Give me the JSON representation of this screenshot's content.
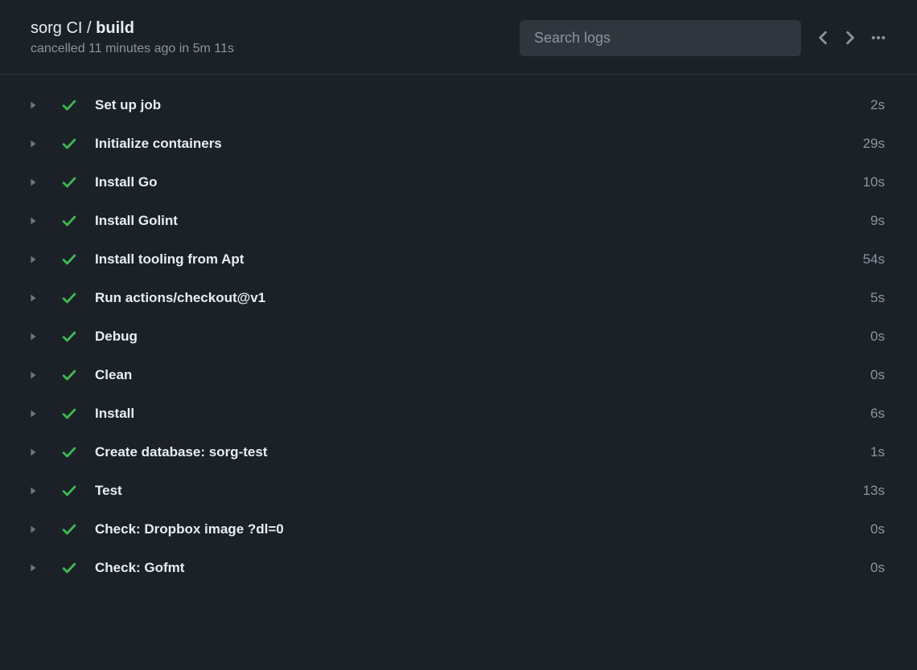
{
  "header": {
    "workflow_name": "sorg CI",
    "separator": " / ",
    "job_name": "build",
    "status_text": "cancelled 11 minutes ago in 5m 11s",
    "search_placeholder": "Search logs"
  },
  "steps": [
    {
      "name": "Set up job",
      "duration": "2s",
      "status": "success"
    },
    {
      "name": "Initialize containers",
      "duration": "29s",
      "status": "success"
    },
    {
      "name": "Install Go",
      "duration": "10s",
      "status": "success"
    },
    {
      "name": "Install Golint",
      "duration": "9s",
      "status": "success"
    },
    {
      "name": "Install tooling from Apt",
      "duration": "54s",
      "status": "success"
    },
    {
      "name": "Run actions/checkout@v1",
      "duration": "5s",
      "status": "success"
    },
    {
      "name": "Debug",
      "duration": "0s",
      "status": "success"
    },
    {
      "name": "Clean",
      "duration": "0s",
      "status": "success"
    },
    {
      "name": "Install",
      "duration": "6s",
      "status": "success"
    },
    {
      "name": "Create database: sorg-test",
      "duration": "1s",
      "status": "success"
    },
    {
      "name": "Test",
      "duration": "13s",
      "status": "success"
    },
    {
      "name": "Check: Dropbox image ?dl=0",
      "duration": "0s",
      "status": "success"
    },
    {
      "name": "Check: Gofmt",
      "duration": "0s",
      "status": "success"
    }
  ]
}
